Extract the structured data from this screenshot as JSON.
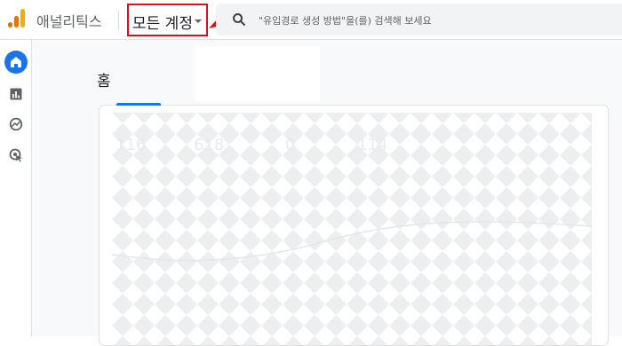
{
  "app": {
    "title": "애널리틱스"
  },
  "account_selector": {
    "label": "모든 계정"
  },
  "search": {
    "placeholder": "\"유입경로 생성 방법\"을(를) 검색해 보세요"
  },
  "nav": {
    "items": [
      {
        "name": "home",
        "icon": "home-icon"
      },
      {
        "name": "reports",
        "icon": "bar-chart-icon"
      },
      {
        "name": "explore",
        "icon": "explore-icon"
      },
      {
        "name": "advertising",
        "icon": "advertising-icon"
      }
    ]
  },
  "main": {
    "page_title": "홈"
  },
  "ghost_metrics": [
    "116",
    "618",
    "0",
    "114"
  ],
  "colors": {
    "accent": "#1a73e8",
    "annotation": "#d3141a",
    "logo_dark": "#e37400",
    "logo_light": "#f9ab00"
  }
}
